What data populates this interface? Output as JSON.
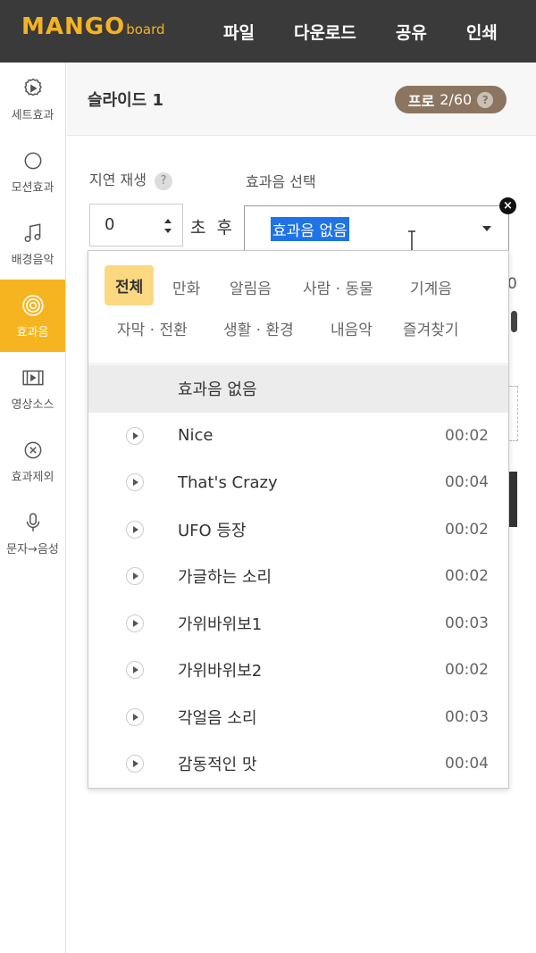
{
  "topbar": {
    "logo_main": "MANGO",
    "logo_sub": "board",
    "menu": [
      "파일",
      "다운로드",
      "공유",
      "인쇄"
    ]
  },
  "sidebar": {
    "items": [
      {
        "label": "세트효과",
        "icon": "gear-icon",
        "active": false
      },
      {
        "label": "모션효과",
        "icon": "circle-icon",
        "active": false
      },
      {
        "label": "배경음악",
        "icon": "music-note-icon",
        "active": false
      },
      {
        "label": "효과음",
        "icon": "concentric-circles-icon",
        "active": true
      },
      {
        "label": "영상소스",
        "icon": "film-icon",
        "active": false
      },
      {
        "label": "효과제외",
        "icon": "x-circle-icon",
        "active": false
      },
      {
        "label": "문자→음성",
        "icon": "microphone-icon",
        "active": false
      }
    ]
  },
  "header": {
    "slide_title": "슬라이드 1",
    "pro_label": "프로",
    "pro_count": "2/60",
    "help": "?"
  },
  "form": {
    "delay_label": "지연 재생",
    "delay_help": "?",
    "delay_value": "0",
    "after_label": "초 후",
    "sound_label": "효과음 선택",
    "selected_sound": "효과음 없음",
    "close": "×",
    "peek_text": "0"
  },
  "dropdown": {
    "categories_row1": [
      "전체",
      "만화",
      "알림음",
      "사람 · 동물",
      "기계음"
    ],
    "categories_row2": [
      "자막 · 전환",
      "생활 · 환경",
      "내음악",
      "즐겨찾기"
    ],
    "active_category": "전체",
    "items": [
      {
        "name": "효과음 없음",
        "duration": "",
        "selected": true
      },
      {
        "name": "Nice",
        "duration": "00:02"
      },
      {
        "name": "That's Crazy",
        "duration": "00:04"
      },
      {
        "name": "UFO 등장",
        "duration": "00:02"
      },
      {
        "name": "가글하는 소리",
        "duration": "00:02"
      },
      {
        "name": "가위바위보1",
        "duration": "00:03"
      },
      {
        "name": "가위바위보2",
        "duration": "00:02"
      },
      {
        "name": "각얼음 소리",
        "duration": "00:03"
      },
      {
        "name": "감동적인 맛",
        "duration": "00:04"
      }
    ]
  },
  "colors": {
    "topbar": "#3a3a3a",
    "accent": "#f6b520",
    "pro_badge": "#8b7560",
    "active_category": "#fcd980",
    "selection": "#1f73e6"
  }
}
